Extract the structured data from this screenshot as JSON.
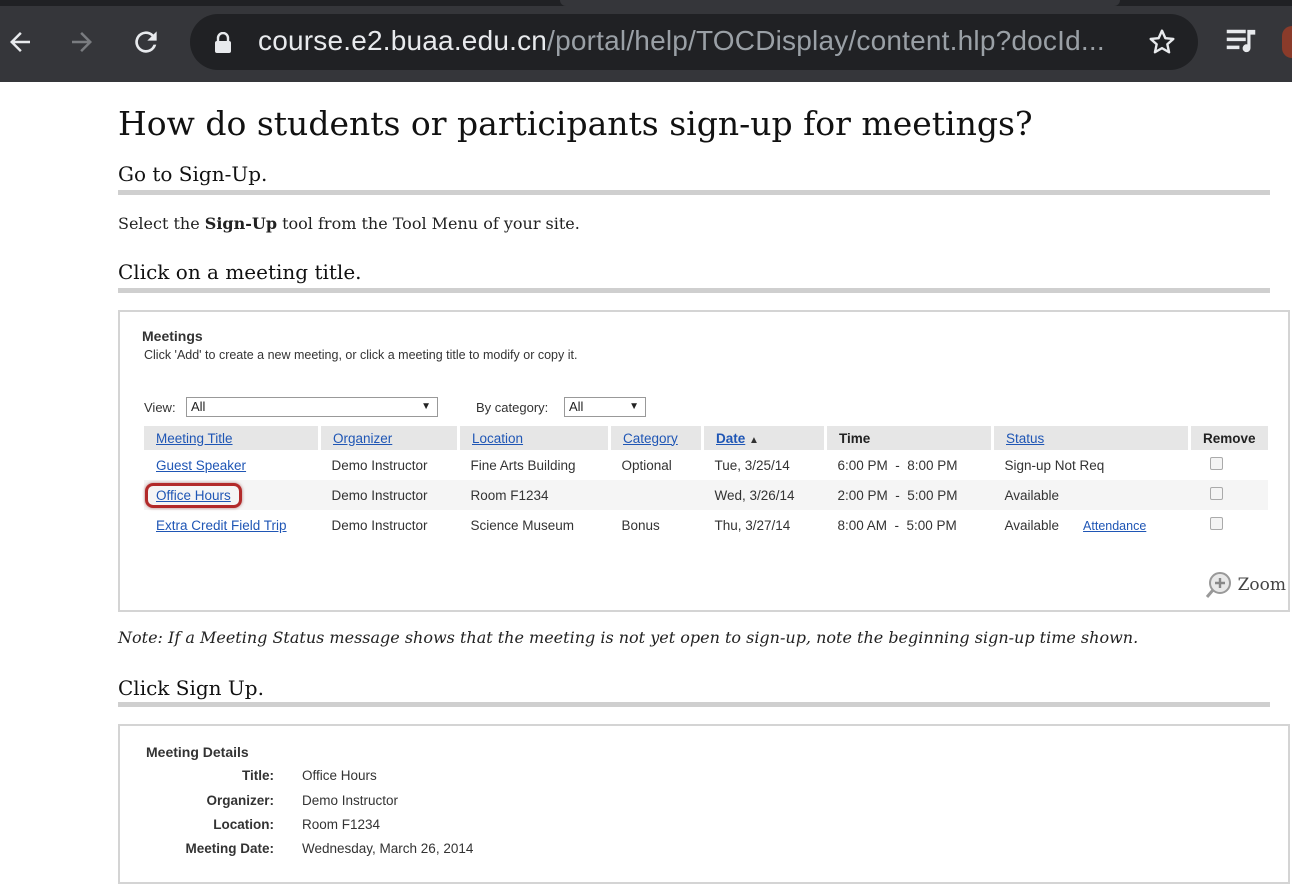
{
  "browser": {
    "url_host": "course.e2.buaa.edu.cn",
    "url_path": "/portal/help/TOCDisplay/content.hlp?docId..."
  },
  "page": {
    "title": "How do students or participants sign-up for meetings?",
    "step1": {
      "title": "Go to Sign-Up.",
      "text_before": "Select the ",
      "text_bold": "Sign-Up",
      "text_after": " tool from the Tool Menu of your site."
    },
    "step2": {
      "title": "Click on a meeting title."
    },
    "note": "Note: If a Meeting Status message shows that the meeting is not yet open to sign-up, note the beginning sign-up time shown.",
    "step3": {
      "title": "Click Sign Up."
    }
  },
  "meetings_panel": {
    "heading": "Meetings",
    "description": "Click 'Add' to create a new meeting, or click a meeting title to modify or copy it.",
    "view_label": "View:",
    "view_value": "All",
    "category_label": "By category:",
    "category_value": "All",
    "columns": [
      "Meeting Title",
      "Organizer",
      "Location",
      "Category",
      "Date",
      "Time",
      "Status",
      "Remove"
    ],
    "rows": [
      {
        "title": "Guest Speaker",
        "organizer": "Demo Instructor",
        "location": "Fine Arts Building",
        "category": "Optional",
        "date": "Tue, 3/25/14",
        "time": "6:00 PM  -  8:00 PM",
        "status": "Sign-up Not Req",
        "extra": ""
      },
      {
        "title": "Office Hours",
        "organizer": "Demo Instructor",
        "location": "Room F1234",
        "category": "",
        "date": "Wed, 3/26/14",
        "time": "2:00 PM  -  5:00 PM",
        "status": "Available",
        "extra": ""
      },
      {
        "title": "Extra Credit Field Trip",
        "organizer": "Demo Instructor",
        "location": "Science Museum",
        "category": "Bonus",
        "date": "Thu, 3/27/14",
        "time": "8:00 AM  -  5:00 PM",
        "status": "Available",
        "extra": "Attendance"
      }
    ],
    "zoom_label": "Zoom"
  },
  "details_panel": {
    "heading": "Meeting Details",
    "fields": [
      {
        "key": "Title:",
        "value": "Office Hours"
      },
      {
        "key": "Organizer:",
        "value": "Demo Instructor"
      },
      {
        "key": "Location:",
        "value": "Room F1234"
      },
      {
        "key": "Meeting Date:",
        "value": "Wednesday, March 26, 2014"
      }
    ]
  }
}
